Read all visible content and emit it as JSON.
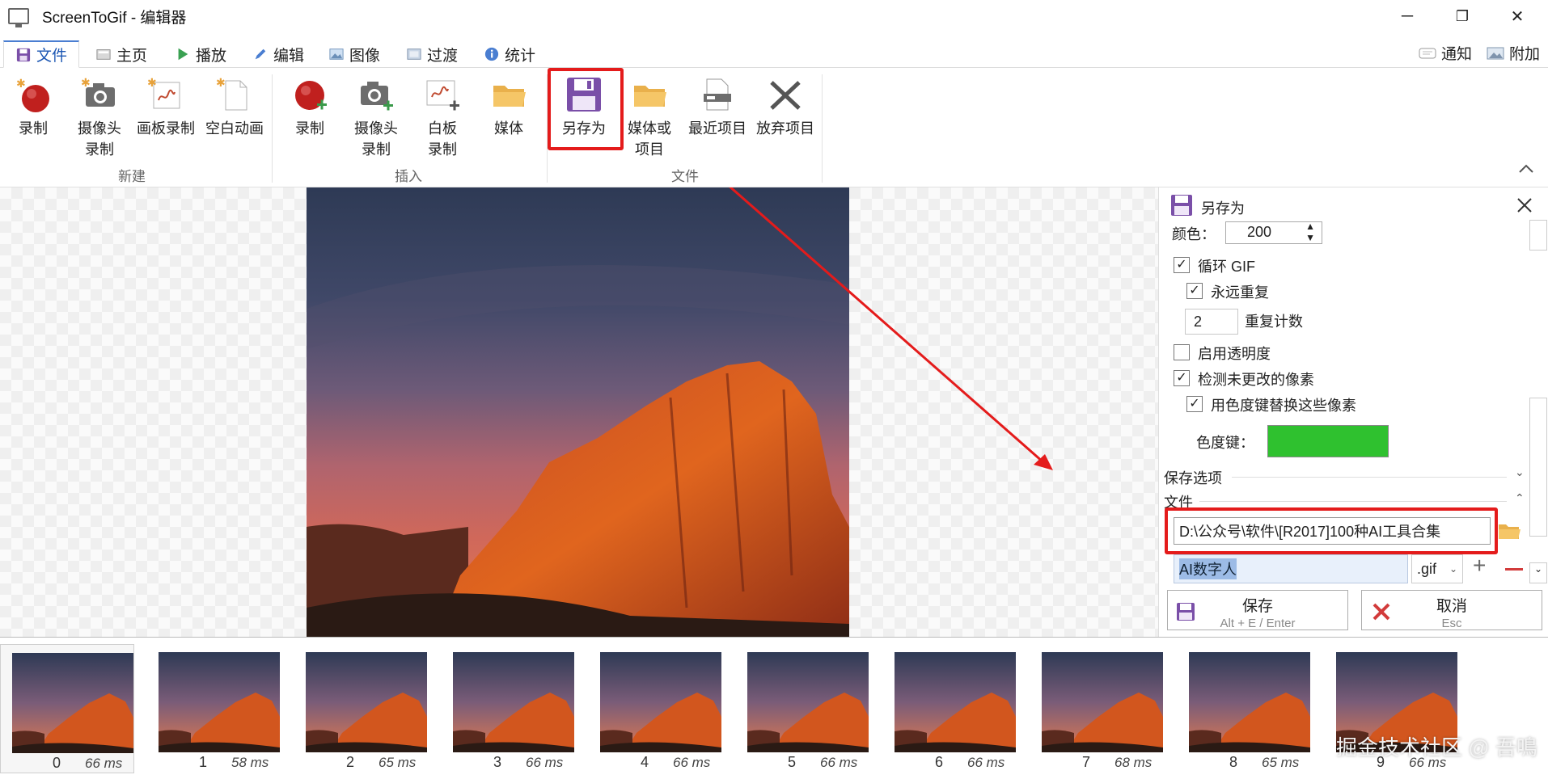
{
  "window": {
    "title": "ScreenToGif - 编辑器",
    "minimize": "─",
    "maximize": "❐",
    "close": "✕"
  },
  "tabs": [
    {
      "label": "文件"
    },
    {
      "label": "主页"
    },
    {
      "label": "播放"
    },
    {
      "label": "编辑"
    },
    {
      "label": "图像"
    },
    {
      "label": "过渡"
    },
    {
      "label": "统计"
    }
  ],
  "topright": {
    "notify": "通知",
    "attach": "附加"
  },
  "ribbon": {
    "new_group": "新建",
    "insert_group": "插入",
    "file_group": "文件",
    "buttons": {
      "record": "录制",
      "camera_l1": "摄像头",
      "camera_l2": "录制",
      "board": "画板录制",
      "blank": "空白动画",
      "ins_record": "录制",
      "ins_camera_l1": "摄像头",
      "ins_camera_l2": "录制",
      "ins_board_l1": "白板",
      "ins_board_l2": "录制",
      "media": "媒体",
      "saveas": "另存为",
      "mediaproj_l1": "媒体或",
      "mediaproj_l2": "项目",
      "recent": "最近项目",
      "discard": "放弃项目"
    }
  },
  "panel": {
    "title": "另存为",
    "color_label": "颜色：",
    "color_value": "200",
    "loop_gif": "循环 GIF",
    "forever": "永远重复",
    "repeat_count_value": "2",
    "repeat_count_label": "重复计数",
    "transparency": "启用透明度",
    "detect_unchanged": "检测未更改的像素",
    "chroma_replace": "用色度键替换这些像素",
    "chroma_key_label": "色度键：",
    "chroma_color": "#2fc12f",
    "save_options": "保存选项",
    "file_section": "文件",
    "path": "D:\\公众号\\软件\\[R2017]100种AI工具合集",
    "filename": "AI数字人",
    "extension": ".gif",
    "save_label": "保存",
    "save_shortcut": "Alt + E / Enter",
    "cancel_label": "取消",
    "cancel_shortcut": "Esc"
  },
  "frames": [
    {
      "index": "0",
      "ms": "66 ms"
    },
    {
      "index": "1",
      "ms": "58 ms"
    },
    {
      "index": "2",
      "ms": "65 ms"
    },
    {
      "index": "3",
      "ms": "66 ms"
    },
    {
      "index": "4",
      "ms": "66 ms"
    },
    {
      "index": "5",
      "ms": "66 ms"
    },
    {
      "index": "6",
      "ms": "66 ms"
    },
    {
      "index": "7",
      "ms": "68 ms"
    },
    {
      "index": "8",
      "ms": "65 ms"
    },
    {
      "index": "9",
      "ms": "66 ms"
    }
  ],
  "watermark": "掘金技术社区 @ 吾鳴",
  "colors": {
    "accent": "#1b56b3",
    "highlight": "#e41b1b",
    "purple": "#7a4fa8",
    "record_red": "#c0201e"
  }
}
